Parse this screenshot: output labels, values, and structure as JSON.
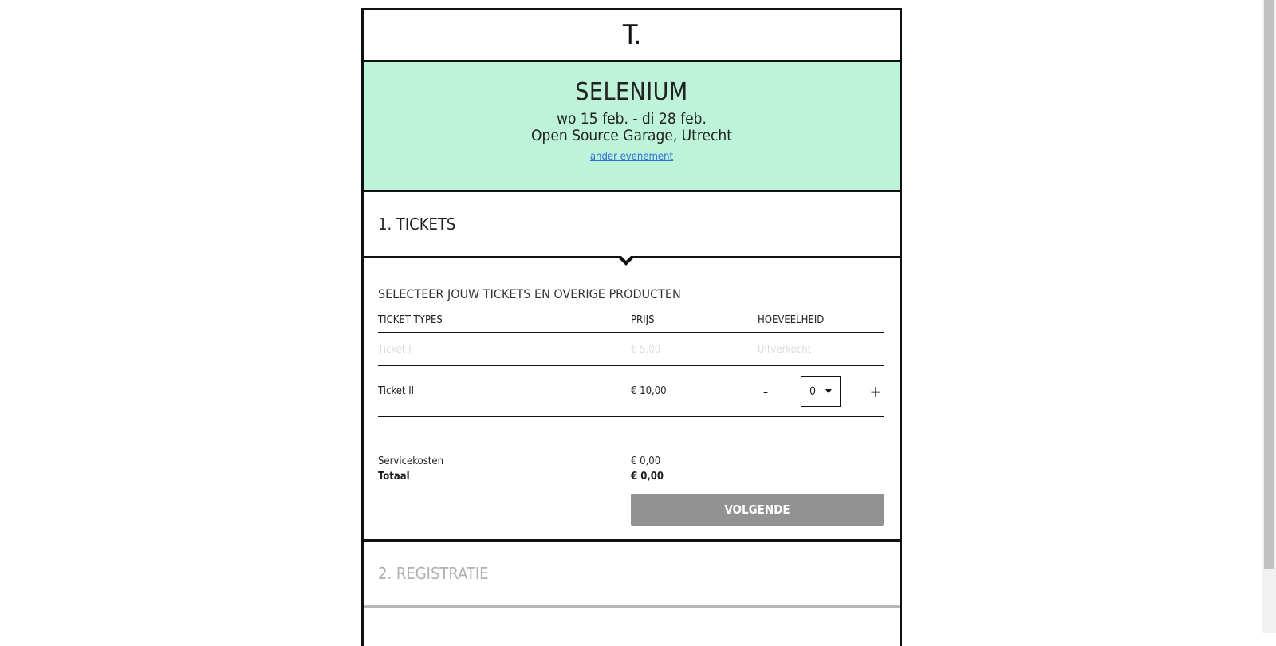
{
  "logo": {
    "text": "T."
  },
  "event": {
    "title": "SELENIUM",
    "dates": "wo 15 feb. - di 28 feb.",
    "venue": "Open Source Garage, Utrecht",
    "other_event_link": "ander evenement"
  },
  "step1": {
    "title": "1. TICKETS"
  },
  "tickets": {
    "section_title": "SELECTEER JOUW TICKETS EN OVERIGE PRODUCTEN",
    "headers": {
      "type": "TICKET TYPES",
      "price": "PRIJS",
      "quantity": "HOEVEELHEID"
    },
    "rows": [
      {
        "name": "Ticket I",
        "price": "€ 5,00",
        "status": "Uitverkocht"
      },
      {
        "name": "Ticket II",
        "price": "€ 10,00",
        "quantity": "0",
        "minus": "-",
        "plus": "+"
      }
    ],
    "service_label": "Servicekosten",
    "service_value": "€ 0,00",
    "total_label": "Totaal",
    "total_value": "€ 0,00",
    "next_button": "VOLGENDE"
  },
  "step2": {
    "title": "2. REGISTRATIE"
  },
  "colors": {
    "event_bg": "#bdf3d9",
    "button_disabled": "#929292",
    "link": "#2a6fd6"
  }
}
